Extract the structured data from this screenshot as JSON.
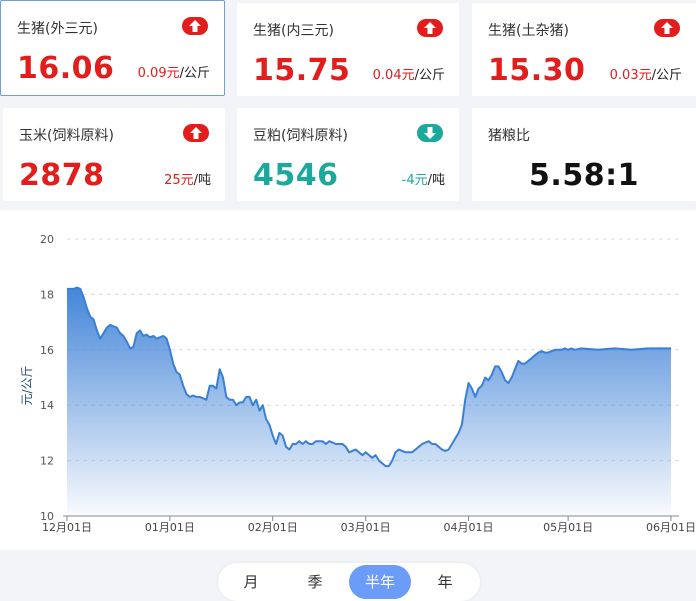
{
  "cards": [
    {
      "title": "生猪(外三元)",
      "value": "16.06",
      "change": "0.09元",
      "unit": "/公斤",
      "trend": "up"
    },
    {
      "title": "生猪(内三元)",
      "value": "15.75",
      "change": "0.04元",
      "unit": "/公斤",
      "trend": "up"
    },
    {
      "title": "生猪(土杂猪)",
      "value": "15.30",
      "change": "0.03元",
      "unit": "/公斤",
      "trend": "up"
    },
    {
      "title": "玉米(饲料原料)",
      "value": "2878",
      "change": "25元",
      "unit": "/吨",
      "trend": "up"
    },
    {
      "title": "豆粕(饲料原料)",
      "value": "4546",
      "change": "-4元",
      "unit": "/吨",
      "trend": "down"
    },
    {
      "title": "猪粮比",
      "value": "5.58:1"
    }
  ],
  "colors": {
    "up": "#e31c1c",
    "down": "#1aa99a",
    "line": "#3a7fd6",
    "accent": "#6b9cf7"
  },
  "icons": {
    "up": "arrow-up-badge",
    "down": "arrow-down-badge"
  },
  "chart_data": {
    "type": "area",
    "ylabel": "元/公斤",
    "ylim": [
      10,
      20
    ],
    "yticks": [
      10,
      12,
      14,
      16,
      18,
      20
    ],
    "xlim": [
      0,
      182
    ],
    "xticks": [
      {
        "label": "12月01日",
        "x": 0
      },
      {
        "label": "01月01日",
        "x": 31
      },
      {
        "label": "02月01日",
        "x": 62
      },
      {
        "label": "03月01日",
        "x": 90
      },
      {
        "label": "04月01日",
        "x": 121
      },
      {
        "label": "05月01日",
        "x": 151
      },
      {
        "label": "06月01日",
        "x": 182
      }
    ],
    "grid": true,
    "series": [
      {
        "points": [
          [
            0,
            18.2
          ],
          [
            2,
            18.2
          ],
          [
            3,
            18.25
          ],
          [
            4,
            18.2
          ],
          [
            5,
            17.9
          ],
          [
            6,
            17.5
          ],
          [
            7,
            17.2
          ],
          [
            8,
            17.1
          ],
          [
            9,
            16.7
          ],
          [
            10,
            16.4
          ],
          [
            11,
            16.6
          ],
          [
            12,
            16.8
          ],
          [
            13,
            16.9
          ],
          [
            14,
            16.85
          ],
          [
            15,
            16.8
          ],
          [
            16,
            16.6
          ],
          [
            17,
            16.5
          ],
          [
            18,
            16.3
          ],
          [
            19,
            16.05
          ],
          [
            20,
            16.1
          ],
          [
            21,
            16.6
          ],
          [
            22,
            16.7
          ],
          [
            23,
            16.5
          ],
          [
            24,
            16.55
          ],
          [
            25,
            16.45
          ],
          [
            26,
            16.5
          ],
          [
            27,
            16.4
          ],
          [
            28,
            16.45
          ],
          [
            29,
            16.5
          ],
          [
            30,
            16.4
          ],
          [
            31,
            16.0
          ],
          [
            32,
            15.5
          ],
          [
            33,
            15.2
          ],
          [
            34,
            15.1
          ],
          [
            35,
            14.7
          ],
          [
            36,
            14.4
          ],
          [
            37,
            14.3
          ],
          [
            38,
            14.35
          ],
          [
            39,
            14.3
          ],
          [
            40,
            14.3
          ],
          [
            41,
            14.25
          ],
          [
            42,
            14.2
          ],
          [
            43,
            14.7
          ],
          [
            44,
            14.7
          ],
          [
            45,
            14.6
          ],
          [
            46,
            15.3
          ],
          [
            47,
            15.0
          ],
          [
            48,
            14.3
          ],
          [
            49,
            14.2
          ],
          [
            50,
            14.2
          ],
          [
            51,
            14.0
          ],
          [
            52,
            14.1
          ],
          [
            53,
            14.1
          ],
          [
            54,
            14.3
          ],
          [
            55,
            14.3
          ],
          [
            56,
            14.0
          ],
          [
            57,
            14.2
          ],
          [
            58,
            13.8
          ],
          [
            59,
            14.0
          ],
          [
            60,
            13.5
          ],
          [
            61,
            13.3
          ],
          [
            62,
            12.9
          ],
          [
            63,
            12.6
          ],
          [
            64,
            13.0
          ],
          [
            65,
            12.9
          ],
          [
            66,
            12.5
          ],
          [
            67,
            12.4
          ],
          [
            68,
            12.6
          ],
          [
            69,
            12.6
          ],
          [
            70,
            12.7
          ],
          [
            71,
            12.6
          ],
          [
            72,
            12.7
          ],
          [
            73,
            12.6
          ],
          [
            74,
            12.6
          ],
          [
            75,
            12.7
          ],
          [
            76,
            12.7
          ],
          [
            77,
            12.7
          ],
          [
            78,
            12.6
          ],
          [
            79,
            12.7
          ],
          [
            80,
            12.65
          ],
          [
            81,
            12.6
          ],
          [
            82,
            12.6
          ],
          [
            83,
            12.6
          ],
          [
            84,
            12.5
          ],
          [
            85,
            12.3
          ],
          [
            86,
            12.35
          ],
          [
            87,
            12.4
          ],
          [
            88,
            12.3
          ],
          [
            89,
            12.2
          ],
          [
            90,
            12.3
          ],
          [
            91,
            12.2
          ],
          [
            92,
            12.1
          ],
          [
            93,
            12.2
          ],
          [
            94,
            12.0
          ],
          [
            95,
            11.9
          ],
          [
            96,
            11.8
          ],
          [
            97,
            11.8
          ],
          [
            98,
            12.0
          ],
          [
            99,
            12.3
          ],
          [
            100,
            12.4
          ],
          [
            101,
            12.35
          ],
          [
            102,
            12.3
          ],
          [
            103,
            12.3
          ],
          [
            104,
            12.3
          ],
          [
            105,
            12.4
          ],
          [
            106,
            12.5
          ],
          [
            107,
            12.6
          ],
          [
            108,
            12.65
          ],
          [
            109,
            12.7
          ],
          [
            110,
            12.6
          ],
          [
            111,
            12.6
          ],
          [
            112,
            12.5
          ],
          [
            113,
            12.4
          ],
          [
            114,
            12.35
          ],
          [
            115,
            12.4
          ],
          [
            116,
            12.6
          ],
          [
            117,
            12.8
          ],
          [
            118,
            13.0
          ],
          [
            119,
            13.3
          ],
          [
            120,
            14.2
          ],
          [
            121,
            14.8
          ],
          [
            122,
            14.6
          ],
          [
            123,
            14.3
          ],
          [
            124,
            14.6
          ],
          [
            125,
            14.7
          ],
          [
            126,
            15.0
          ],
          [
            127,
            14.9
          ],
          [
            128,
            15.1
          ],
          [
            129,
            15.4
          ],
          [
            130,
            15.4
          ],
          [
            131,
            15.2
          ],
          [
            132,
            14.9
          ],
          [
            133,
            14.8
          ],
          [
            134,
            15.0
          ],
          [
            135,
            15.3
          ],
          [
            136,
            15.6
          ],
          [
            137,
            15.5
          ],
          [
            138,
            15.5
          ],
          [
            139,
            15.6
          ],
          [
            140,
            15.7
          ],
          [
            141,
            15.8
          ],
          [
            142,
            15.9
          ],
          [
            143,
            15.95
          ],
          [
            144,
            15.9
          ],
          [
            145,
            15.9
          ],
          [
            146,
            15.95
          ],
          [
            147,
            16.0
          ],
          [
            148,
            16.0
          ],
          [
            149,
            16.0
          ],
          [
            150,
            16.05
          ],
          [
            151,
            16.0
          ],
          [
            152,
            16.05
          ],
          [
            153,
            16.0
          ],
          [
            155,
            16.05
          ],
          [
            160,
            16.0
          ],
          [
            165,
            16.05
          ],
          [
            170,
            16.0
          ],
          [
            175,
            16.05
          ],
          [
            182,
            16.05
          ]
        ]
      }
    ]
  },
  "segments": [
    "月",
    "季",
    "半年",
    "年"
  ],
  "active_segment": "半年"
}
